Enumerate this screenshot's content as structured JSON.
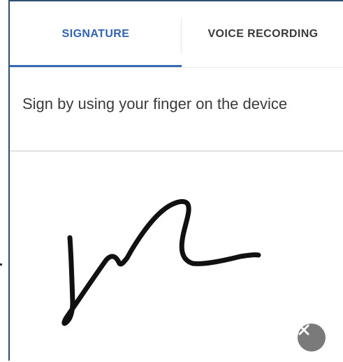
{
  "tabs": {
    "signature_label": "SIGNATURE",
    "voice_label": "VOICE RECORDING",
    "active": "SIGNATURE"
  },
  "instruction_text": "Sign by using your finger on the device",
  "colors": {
    "active_tab": "#2f64b4",
    "inactive_tab": "#3a3a3a",
    "clear_button": "#7a7a7a"
  },
  "icons": {
    "clear": "close-icon"
  }
}
